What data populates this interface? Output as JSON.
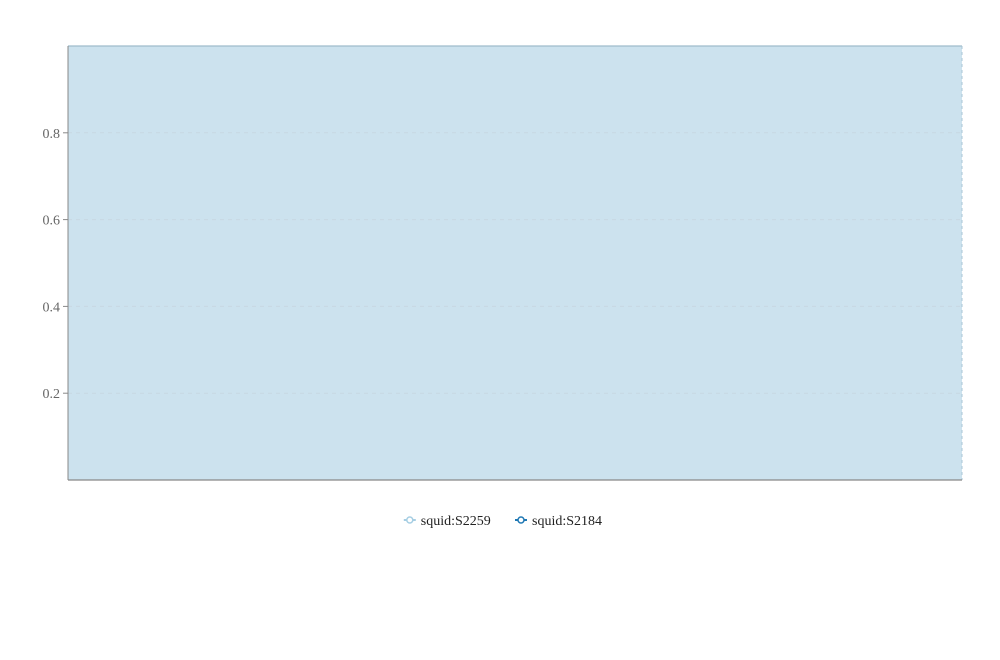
{
  "chart_data": {
    "type": "area",
    "title": "",
    "xlabel": "",
    "ylabel": "",
    "ylim": [
      0,
      1
    ],
    "y_ticks": [
      0.2,
      0.4,
      0.6,
      0.8
    ],
    "y_tick_labels": [
      "0.2",
      "0.4",
      "0.6",
      "0.8"
    ],
    "grid": "horizontal dashed",
    "legend_position": "bottom-center",
    "series": [
      {
        "name": "squid:S2259",
        "color": "#a6cee3",
        "values": [
          1,
          1
        ]
      },
      {
        "name": "squid:S2184",
        "color": "#1f78b4",
        "values": [
          0,
          0
        ]
      }
    ],
    "fill_color": "#cce2ee",
    "axis_color": "#888888",
    "grid_color": "#c7d8e2"
  }
}
